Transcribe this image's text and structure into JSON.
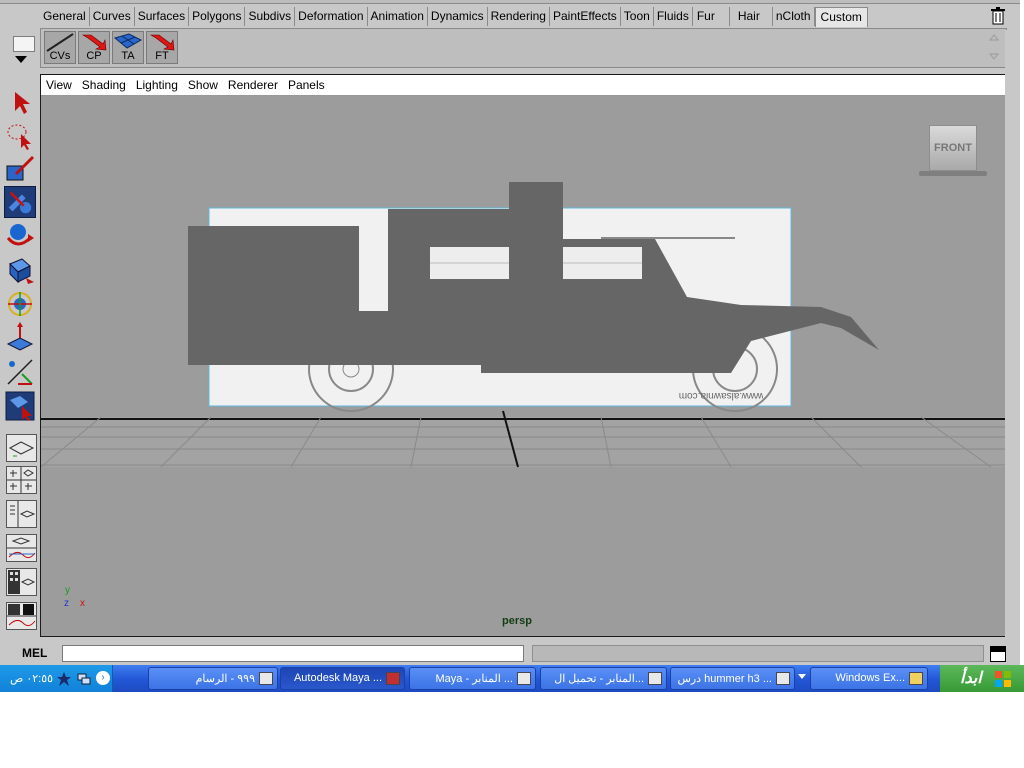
{
  "shelf": {
    "tabs": [
      "General",
      "Curves",
      "Surfaces",
      "Polygons",
      "Subdivs",
      "Deformation",
      "Animation",
      "Dynamics",
      "Rendering",
      "PaintEffects",
      "Toon",
      "Fluids",
      "Fur",
      "Hair",
      "nCloth",
      "Custom"
    ],
    "active_tab": "Custom",
    "buttons": [
      {
        "label": "CVs",
        "icon": "cv-curve-tool-icon"
      },
      {
        "label": "CP",
        "icon": "red-arrow-icon"
      },
      {
        "label": "TA",
        "icon": "blue-plane-icon"
      },
      {
        "label": "FT",
        "icon": "red-arrow-icon"
      }
    ]
  },
  "toolbox": {
    "tools": [
      "select-tool-icon",
      "lasso-tool-icon",
      "paint-select-tool-icon",
      "paint-tool-icon",
      "move-tool-icon",
      "rotate-tool-icon",
      "scale-tool-icon",
      "manipulator-icon",
      "soft-modify-icon",
      "last-tool-icon"
    ],
    "selected_index": 3,
    "layouts": [
      "single-view-layout-icon",
      "four-view-layout-icon",
      "outliner-persp-layout-icon",
      "graph-persp-layout-icon",
      "hypershade-persp-layout-icon",
      "persp-graph-layout-icon"
    ]
  },
  "panel": {
    "menus": [
      "View",
      "Shading",
      "Lighting",
      "Show",
      "Renderer",
      "Panels"
    ],
    "camera_label": "persp",
    "view_cube_label": "FRONT",
    "image_plane_watermark": "www.alsawnia.com",
    "axis": {
      "y": "y",
      "z": "z",
      "x": "x"
    }
  },
  "command_line": {
    "label": "MEL",
    "value": ""
  },
  "taskbar": {
    "start_label": "ابدأ",
    "clock": "٠٢:٥٥ ص",
    "tasks": [
      {
        "label": "Windows Ex..."
      },
      {
        "label": "درس hummer h3 ..."
      },
      {
        "label": "المنابر - تحميل ال..."
      },
      {
        "label": "Maya - المنابر ..."
      },
      {
        "label": "Autodesk Maya ..."
      },
      {
        "label": "٩٩٩ - الرسام"
      }
    ],
    "pressed_task": "Autodesk Maya ..."
  },
  "colors": {
    "viewport_bg": "#9c9c9c",
    "model": "#666666",
    "taskbar": "#2458d8",
    "start": "#379a36",
    "selected_tool": "#1f3c78"
  }
}
